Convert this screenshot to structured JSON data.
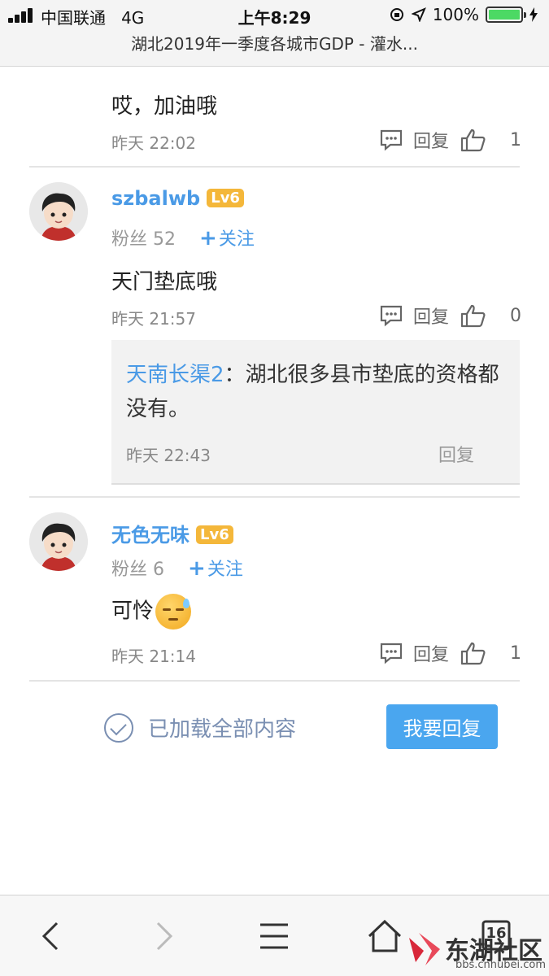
{
  "status_bar": {
    "carrier": "中国联通",
    "network": "4G",
    "time": "上午8:29",
    "battery": "100%"
  },
  "page": {
    "title": "湖北2019年一季度各城市GDP - 灌水..."
  },
  "comments": [
    {
      "text": "哎，加油哦",
      "time": "昨天 22:02",
      "reply_label": "回复",
      "likes": "1"
    },
    {
      "username": "szbalwb",
      "level": "Lv6",
      "fans_label": "粉丝",
      "fans_count": "52",
      "follow_label": "关注",
      "text": "天门垫底哦",
      "time": "昨天 21:57",
      "reply_label": "回复",
      "likes": "0",
      "subreply": {
        "user": "天南长渠2",
        "separator": "：",
        "text": "湖北很多县市垫底的资格都没有。",
        "time": "昨天 22:43",
        "reply_label": "回复"
      }
    },
    {
      "username": "无色无味",
      "level": "Lv6",
      "fans_label": "粉丝",
      "fans_count": "6",
      "follow_label": "关注",
      "text": "可怜",
      "emoji": "sweat-face-icon",
      "time": "昨天 21:14",
      "reply_label": "回复",
      "likes": "1"
    }
  ],
  "footer": {
    "loaded_text": "已加载全部内容",
    "reply_button": "我要回复"
  },
  "toolbar": {
    "tabs_count": "16",
    "watermark_text": "东湖社区",
    "watermark_url": "bbs.cnhubei.com"
  },
  "colors": {
    "link_blue": "#4a9ae6",
    "level_badge": "#f4b73a",
    "reply_button": "#4aa6ef",
    "battery_green": "#4cd964"
  }
}
